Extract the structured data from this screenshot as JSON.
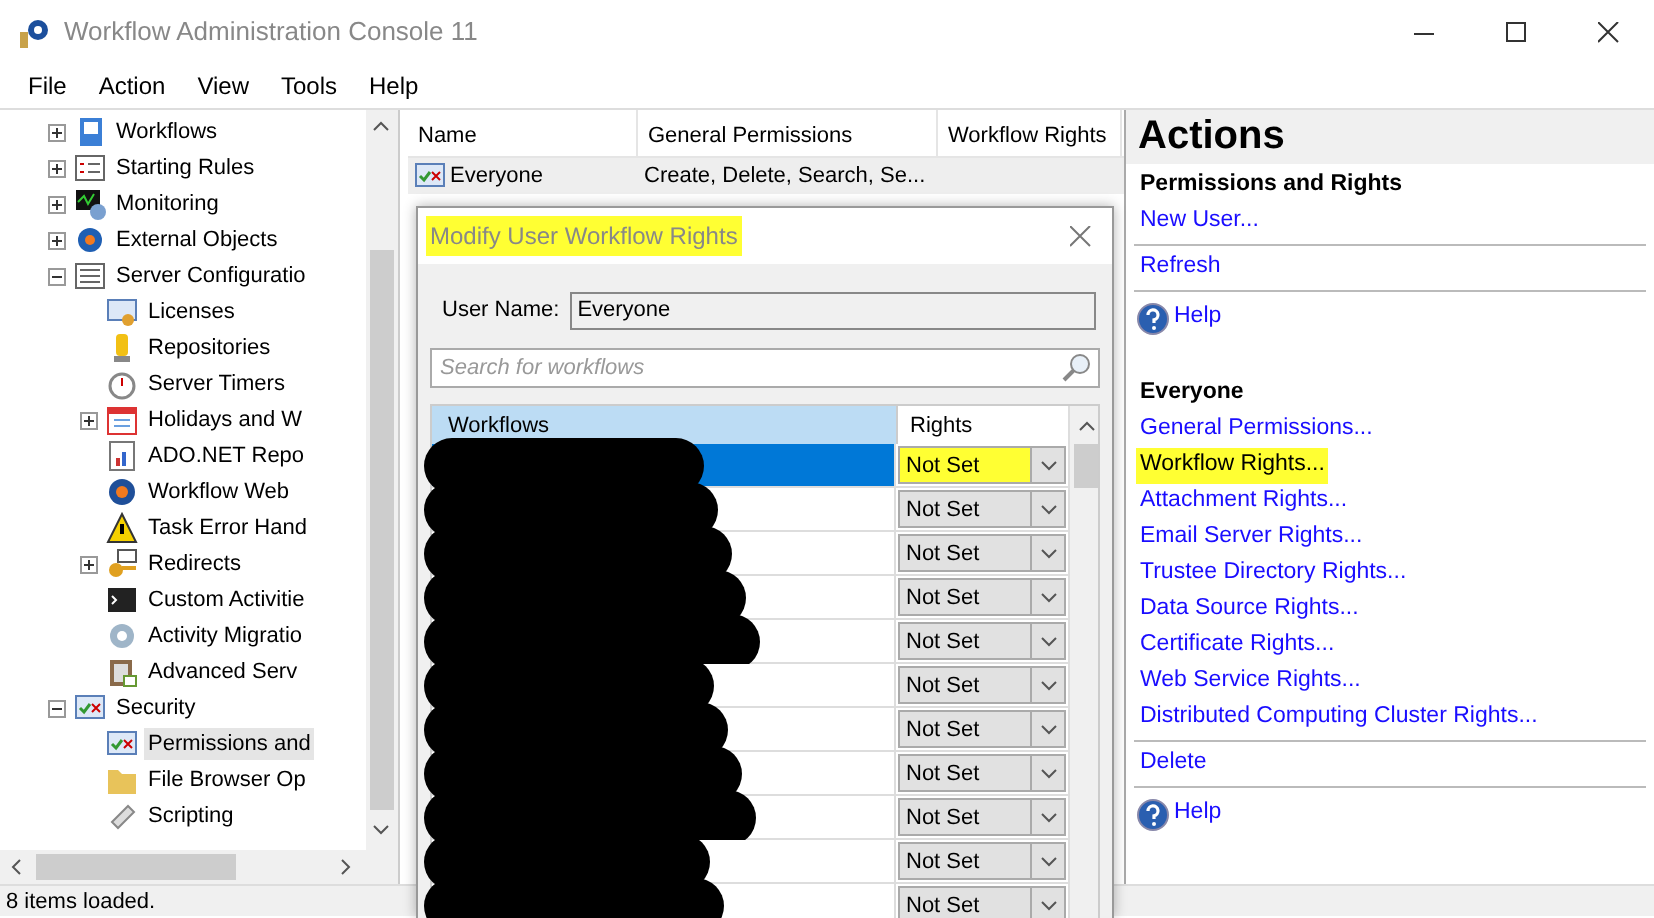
{
  "window": {
    "title": "Workflow Administration Console 11"
  },
  "menu": [
    "File",
    "Action",
    "View",
    "Tools",
    "Help"
  ],
  "tree": [
    {
      "label": "Workflows",
      "expanded": false,
      "selected": false
    },
    {
      "label": "Starting Rules",
      "expanded": false,
      "selected": false
    },
    {
      "label": "Monitoring",
      "expanded": false,
      "selected": false
    },
    {
      "label": "External Objects",
      "expanded": false,
      "selected": false
    },
    {
      "label": "Server Configuratio",
      "expanded": true,
      "selected": false,
      "children": [
        {
          "label": "Licenses",
          "selected": false
        },
        {
          "label": "Repositories",
          "selected": false
        },
        {
          "label": "Server Timers",
          "selected": false
        },
        {
          "label": "Holidays and W",
          "expanded": false,
          "selected": false
        },
        {
          "label": "ADO.NET Repo",
          "selected": false
        },
        {
          "label": "Workflow Web",
          "selected": false
        },
        {
          "label": "Task Error Hand",
          "selected": false
        },
        {
          "label": "Redirects",
          "expanded": false,
          "selected": false
        },
        {
          "label": "Custom Activitie",
          "selected": false
        },
        {
          "label": "Activity Migratio",
          "selected": false
        },
        {
          "label": "Advanced Serv",
          "selected": false
        }
      ]
    },
    {
      "label": "Security",
      "expanded": true,
      "selected": false,
      "children": [
        {
          "label": "Permissions and",
          "selected": true
        },
        {
          "label": "File Browser Op",
          "selected": false
        },
        {
          "label": "Scripting",
          "selected": false
        }
      ]
    }
  ],
  "list": {
    "columns": [
      "Name",
      "General Permissions",
      "Workflow Rights"
    ],
    "rows": [
      {
        "cells": [
          "Everyone",
          "Create, Delete, Search, Se..."
        ],
        "selected": false
      }
    ]
  },
  "dialog": {
    "title": "Modify User Workflow Rights",
    "title_highlighted": true,
    "user_name_label": "User Name:",
    "user_name": "Everyone",
    "search_placeholder": "Search for workflows",
    "columns": [
      "Workflows",
      "Rights"
    ],
    "rows": [
      {
        "name_redacted": true,
        "rights": "Not Set",
        "selected": true,
        "highlighted": true
      },
      {
        "name_redacted": true,
        "rights": "Not Set",
        "selected": false,
        "highlighted": false
      },
      {
        "name_redacted": true,
        "rights": "Not Set",
        "selected": false,
        "highlighted": false
      },
      {
        "name_redacted": true,
        "rights": "Not Set",
        "selected": false,
        "highlighted": false
      },
      {
        "name_redacted": true,
        "rights": "Not Set",
        "selected": false,
        "highlighted": false
      },
      {
        "name_redacted": true,
        "rights": "Not Set",
        "selected": false,
        "highlighted": false
      },
      {
        "name_redacted": true,
        "rights": "Not Set",
        "selected": false,
        "highlighted": false
      },
      {
        "name_redacted": true,
        "rights": "Not Set",
        "selected": false,
        "highlighted": false
      },
      {
        "name_redacted": true,
        "rights": "Not Set",
        "selected": false,
        "highlighted": false
      },
      {
        "name_redacted": true,
        "rights": "Not Set",
        "selected": false,
        "highlighted": false
      },
      {
        "name_redacted": true,
        "rights": "Not Set",
        "selected": false,
        "highlighted": false
      }
    ]
  },
  "actions": {
    "title": "Actions",
    "items": [
      {
        "kind": "heading",
        "text": "Permissions and Rights"
      },
      {
        "kind": "link",
        "text": "New User...",
        "highlighted": false
      },
      {
        "kind": "separator"
      },
      {
        "kind": "link",
        "text": "Refresh",
        "highlighted": false
      },
      {
        "kind": "separator"
      },
      {
        "kind": "help",
        "text": "Help"
      },
      {
        "kind": "gap"
      },
      {
        "kind": "heading",
        "text": "Everyone"
      },
      {
        "kind": "link",
        "text": "General Permissions...",
        "highlighted": false
      },
      {
        "kind": "link",
        "text": "Workflow Rights...",
        "highlighted": true
      },
      {
        "kind": "link",
        "text": "Attachment Rights...",
        "highlighted": false
      },
      {
        "kind": "link",
        "text": "Email Server Rights...",
        "highlighted": false
      },
      {
        "kind": "link",
        "text": "Trustee Directory Rights...",
        "highlighted": false
      },
      {
        "kind": "link",
        "text": "Data Source Rights...",
        "highlighted": false
      },
      {
        "kind": "link",
        "text": "Certificate Rights...",
        "highlighted": false
      },
      {
        "kind": "link",
        "text": "Web Service Rights...",
        "highlighted": false
      },
      {
        "kind": "link",
        "text": "Distributed Computing Cluster Rights...",
        "highlighted": false
      },
      {
        "kind": "separator"
      },
      {
        "kind": "link",
        "text": "Delete",
        "highlighted": false
      },
      {
        "kind": "separator"
      },
      {
        "kind": "help",
        "text": "Help"
      }
    ]
  },
  "status_bar": "8 items loaded."
}
